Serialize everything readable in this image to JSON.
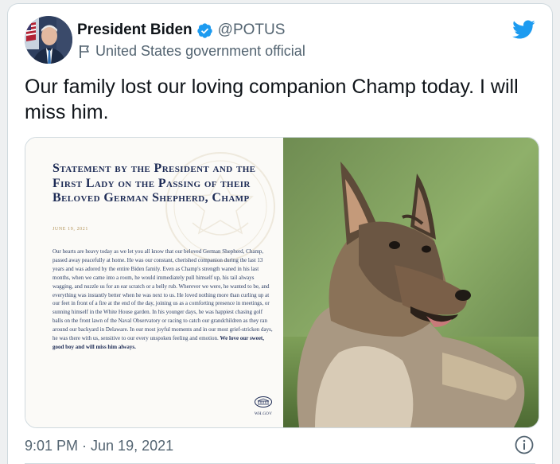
{
  "author": {
    "display_name": "President Biden",
    "handle": "@POTUS",
    "affiliation": "United States government official"
  },
  "tweet": {
    "text": "Our family lost our loving companion Champ today. I will miss him.",
    "timestamp": "9:01 PM · Jun 19, 2021"
  },
  "statement": {
    "title": "Statement by the President and the First Lady on the Passing of their Beloved German Shepherd, Champ",
    "date": "JUNE 19, 2021",
    "body": "Our hearts are heavy today as we let you all know that our beloved German Shepherd, Champ, passed away peacefully at home. He was our constant, cherished companion during the last 13 years and was adored by the entire Biden family. Even as Champ's strength waned in his last months, when we came into a room, he would immediately pull himself up, his tail always wagging, and nuzzle us for an ear scratch or a belly rub. Wherever we were, he wanted to be, and everything was instantly better when he was next to us. He loved nothing more than curling up at our feet in front of a fire at the end of the day, joining us as a comforting presence in meetings, or sunning himself in the White House garden. In his younger days, he was happiest chasing golf balls on the front lawn of the Naval Observatory or racing to catch our grandchildren as they ran around our backyard in Delaware. In our most joyful moments and in our most grief-stricken days, he was there with us, sensitive to our every unspoken feeling and emotion.",
    "closing": "We love our sweet, good boy and will miss him always.",
    "logo_text": "WH.GOV"
  },
  "icons": {
    "verified": "verified-badge-icon",
    "affiliation": "flag-icon",
    "brand": "twitter-bird-icon",
    "info": "info-icon"
  },
  "colors": {
    "brand_blue": "#1d9bf0",
    "secondary_text": "#536471",
    "primary_text": "#0f1419",
    "statement_navy": "#1d2b55",
    "statement_gold": "#b3945a"
  }
}
